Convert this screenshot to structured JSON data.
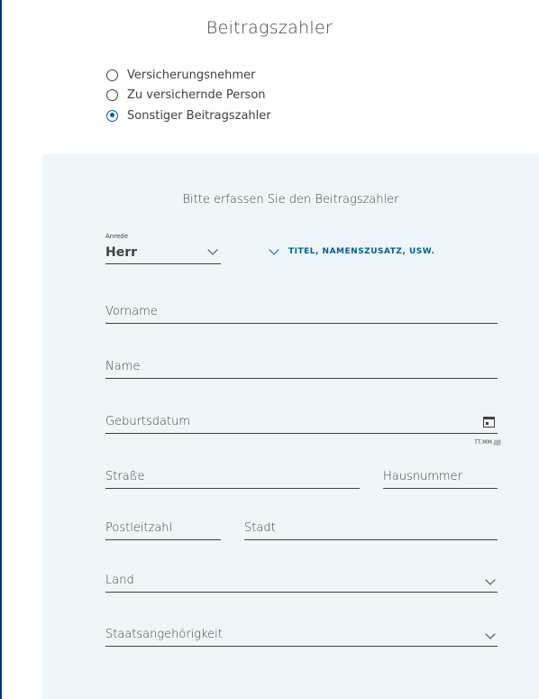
{
  "page": {
    "title": "Beitragszahler"
  },
  "payer_options": [
    {
      "label": "Versicherungsnehmer",
      "checked": false
    },
    {
      "label": "Zu versichernde Person",
      "checked": false
    },
    {
      "label": "Sonstiger Beitragszahler",
      "checked": true
    }
  ],
  "form": {
    "heading": "Bitte erfassen Sie den Beitragszahler",
    "anrede": {
      "label": "Anrede",
      "value": "Herr"
    },
    "titel_link": "TITEL, NAMENSZUSATZ, USW.",
    "vorname": {
      "placeholder": "Vorname"
    },
    "name": {
      "placeholder": "Name"
    },
    "geburtsdatum": {
      "placeholder": "Geburtsdatum",
      "hint": "TT.MM.JJJJ"
    },
    "strasse": {
      "placeholder": "Straße"
    },
    "hausnummer": {
      "placeholder": "Hausnummer"
    },
    "postleitzahl": {
      "placeholder": "Postleitzahl"
    },
    "stadt": {
      "placeholder": "Stadt"
    },
    "land": {
      "placeholder": "Land"
    },
    "staatsangehoerigkeit": {
      "placeholder": "Staatsangehörigkeit"
    }
  },
  "colors": {
    "accent": "#006192",
    "panel_bg": "#eef6f9",
    "frame": "#003781",
    "text": "#414141"
  },
  "icons": {
    "dropdown": "chevron-down-icon",
    "calendar": "calendar-icon"
  }
}
